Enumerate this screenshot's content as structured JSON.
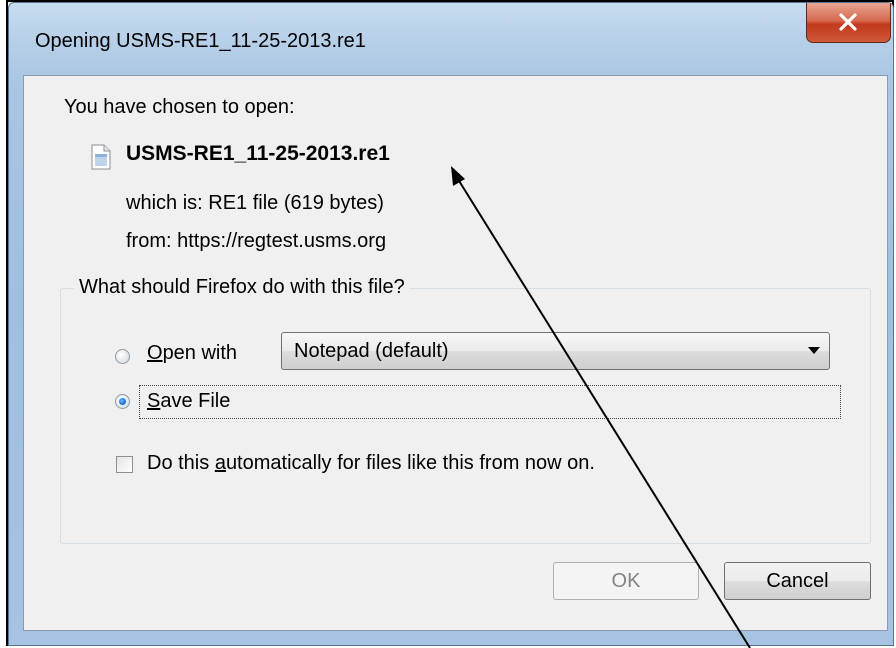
{
  "window": {
    "title": "Opening USMS-RE1_11-25-2013.re1",
    "close_label": "close-icon"
  },
  "dialog": {
    "chosen_label": "You have chosen to open:",
    "filename": "USMS-RE1_11-25-2013.re1",
    "which_is": "which is:  RE1 file (619 bytes)",
    "from": "from:  https://regtest.usms.org",
    "group_legend": "What should Firefox do with this file?",
    "open_with": {
      "mnemonic": "O",
      "rest": "pen with",
      "selected": false
    },
    "open_with_app": "Notepad (default)",
    "save_file": {
      "mnemonic": "S",
      "rest": "ave File",
      "selected": true
    },
    "auto": {
      "before": "Do this ",
      "mnemonic": "a",
      "after": "utomatically for files like this from now on.",
      "checked": false
    },
    "ok_label": "OK",
    "cancel_label": "Cancel"
  },
  "colors": {
    "window_chrome": "#a9c6e3",
    "client_bg": "#f0f0f0",
    "close_red": "#c2381c"
  }
}
